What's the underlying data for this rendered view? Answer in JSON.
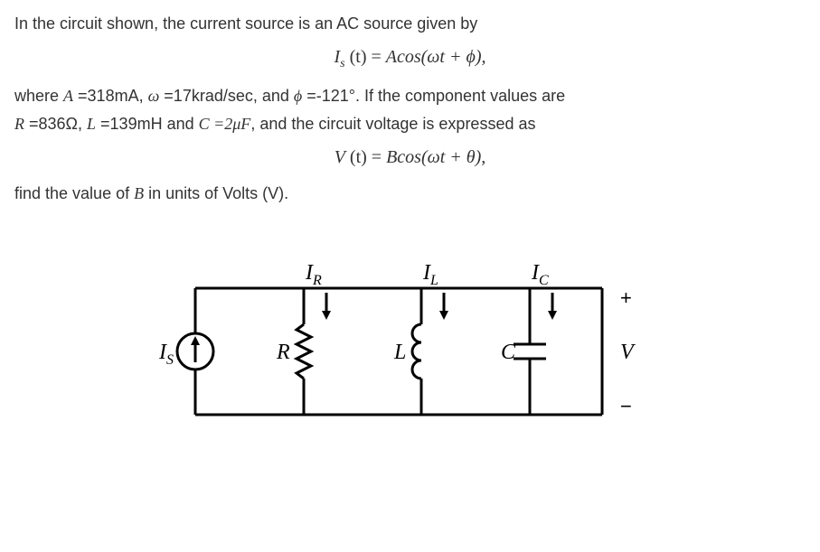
{
  "problem": {
    "line1": "In the circuit shown, the current source is an AC source given by",
    "eq1_lhs": "I",
    "eq1_sub": "s",
    "eq1_t": " (t) = ",
    "eq1_rhs": "Acos(ωt + ϕ),",
    "line2_prefix": "where ",
    "A_sym": "A",
    "A_val": " =318mA, ",
    "w_sym": "ω",
    "w_val": " =17krad/sec, and ",
    "phi_sym": "ϕ",
    "phi_val": " =-121°",
    "line2_suffix": ".  If the component values are",
    "line3_R_sym": "R",
    "line3_R_val": " =836Ω, ",
    "line3_L_sym": "L",
    "line3_L_val": " =139mH and ",
    "line3_C_sym": "C",
    "line3_C_val": " =2μF",
    "line3_suffix": ", and the circuit voltage is expressed as",
    "eq2_lhs": "V",
    "eq2_t": " (t) = ",
    "eq2_rhs": "Bcos(ωt + θ),",
    "line4_prefix": "find the value of ",
    "line4_B": "B",
    "line4_suffix": " in units of Volts (V)."
  },
  "circuit": {
    "Is_label": "I",
    "Is_sub": "S",
    "R_label": "R",
    "IR_label": "I",
    "IR_sub": "R",
    "L_label": "L",
    "IL_label": "I",
    "IL_sub": "L",
    "C_label": "C",
    "IC_label": "I",
    "IC_sub": "C",
    "V_label": "V",
    "plus": "+",
    "minus": "−"
  }
}
